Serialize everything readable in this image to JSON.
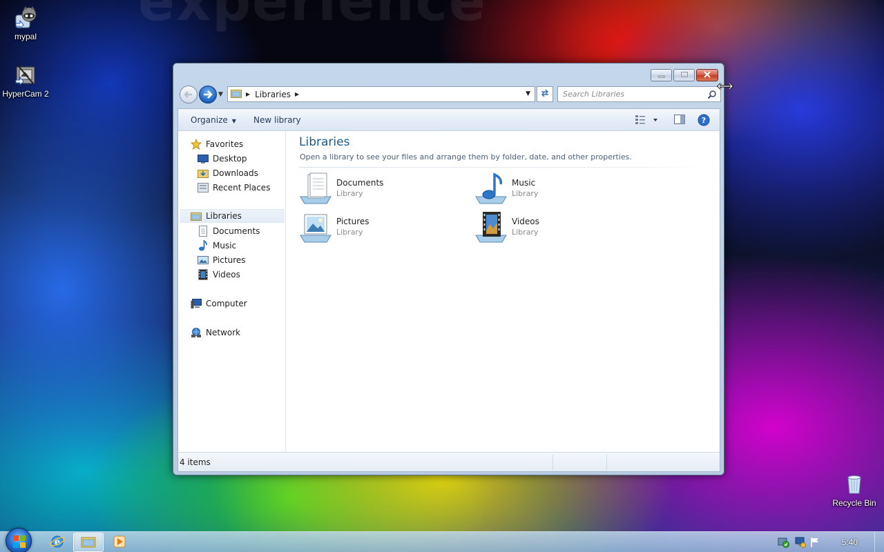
{
  "wallpaper": {
    "watermark": "experience"
  },
  "desktop_icons": [
    {
      "label": "mypal",
      "icon": "mypal-raccoon-icon"
    },
    {
      "label": "HyperCam 2",
      "icon": "hypercam-icon"
    },
    {
      "label": "Recycle Bin",
      "icon": "recycle-bin-icon"
    }
  ],
  "window": {
    "controls": {
      "minimize": "minimize",
      "maximize": "maximize",
      "close": "close"
    },
    "address": {
      "crumb": "Libraries"
    },
    "search": {
      "placeholder": "Search Libraries"
    },
    "toolbar": {
      "organize": "Organize",
      "new_library": "New library"
    },
    "nav": {
      "favorites": "Favorites",
      "desktop": "Desktop",
      "downloads": "Downloads",
      "recent_places": "Recent Places",
      "libraries": "Libraries",
      "documents": "Documents",
      "music": "Music",
      "pictures": "Pictures",
      "videos": "Videos",
      "computer": "Computer",
      "network": "Network"
    },
    "content": {
      "title": "Libraries",
      "description": "Open a library to see your files and arrange them by folder, date, and other properties.",
      "libraries": [
        {
          "name": "Documents",
          "type": "Library",
          "icon": "documents-library-icon"
        },
        {
          "name": "Music",
          "type": "Library",
          "icon": "music-library-icon"
        },
        {
          "name": "Pictures",
          "type": "Library",
          "icon": "pictures-library-icon"
        },
        {
          "name": "Videos",
          "type": "Library",
          "icon": "videos-library-icon"
        }
      ]
    },
    "status": {
      "items": "4 items"
    }
  },
  "taskbar": {
    "apps": [
      "internet-explorer-icon",
      "windows-explorer-icon",
      "media-player-icon"
    ],
    "clock": "5:40"
  },
  "colors": {
    "title_blue": "#1d5a8a",
    "link_text": "#1e395b",
    "close_red": "#c53a22"
  }
}
